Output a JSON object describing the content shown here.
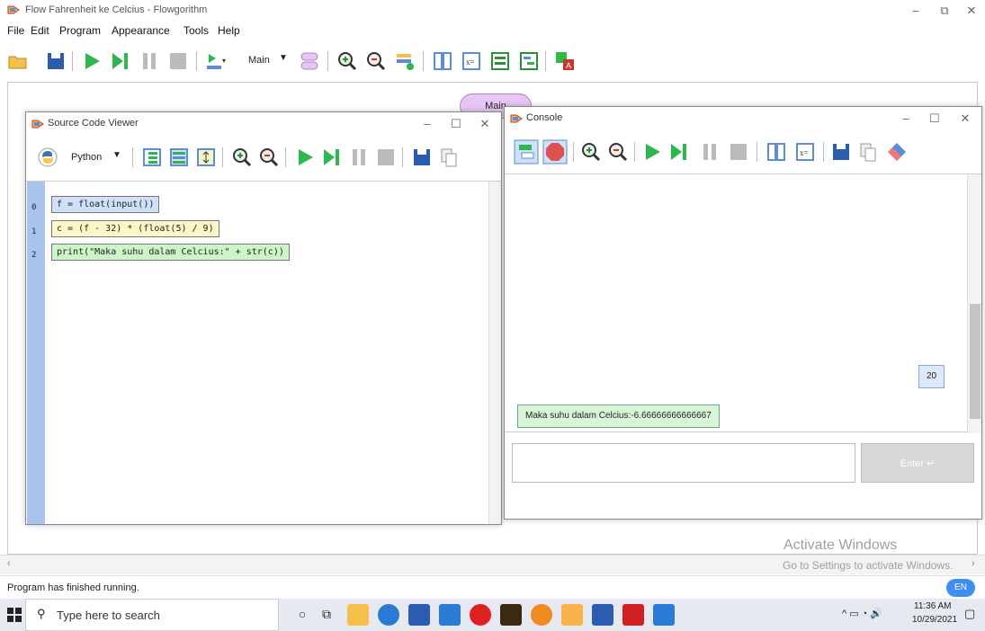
{
  "app": {
    "title": "Flow Fahrenheit ke Celcius - Flowgorithm",
    "menu": [
      "File",
      "Edit",
      "Program",
      "Appearance",
      "Tools",
      "Help"
    ],
    "function_select": "Main",
    "main_tab": "Main",
    "status": "Program has finished running.",
    "language_badge": "EN",
    "watermark_title": "Activate Windows",
    "watermark_sub": "Go to Settings to activate Windows."
  },
  "source_viewer": {
    "title": "Source Code Viewer",
    "language": "Python",
    "lines": [
      {
        "num": "0",
        "code": "f = float(input())",
        "color": "#cfe0f8"
      },
      {
        "num": "1",
        "code": "c = (f - 32) * (float(5) / 9)",
        "color": "#fff6c8"
      },
      {
        "num": "2",
        "code": "print(\"Maka suhu dalam Celcius:\" + str(c))",
        "color": "#ccf5c8"
      }
    ]
  },
  "console": {
    "title": "Console",
    "input_value": "20",
    "output_value": "Maka suhu dalam Celcius:-6.66666666666667",
    "input_placeholder": "",
    "enter_label": "Enter"
  },
  "taskbar": {
    "search_placeholder": "Type here to search",
    "time": "11:36 AM",
    "date": "10/29/2021"
  },
  "colors": {
    "accent_green": "#2db84d",
    "main_pill": "#e6c6f5",
    "gutter": "#a8c4ee"
  }
}
